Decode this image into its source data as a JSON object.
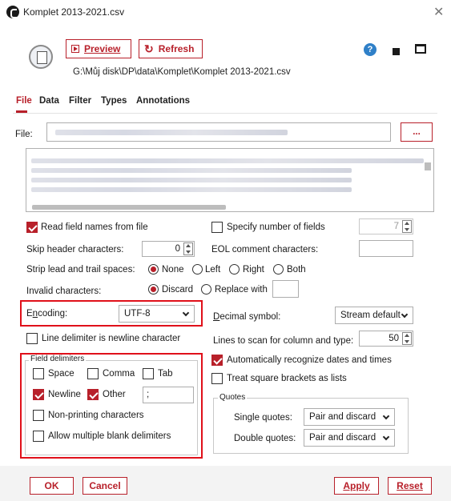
{
  "window": {
    "title": "Komplet 2013-2021.csv"
  },
  "header": {
    "preview_label": "Preview",
    "refresh_label": "Refresh",
    "path": "G:\\Můj disk\\DP\\data\\Komplet\\Komplet 2013-2021.csv"
  },
  "tabs": [
    "File",
    "Data",
    "Filter",
    "Types",
    "Annotations"
  ],
  "file": {
    "label": "File:",
    "browse": "..."
  },
  "options": {
    "read_field_names": "Read field names from file",
    "specify_num_fields": "Specify number of fields",
    "num_fields_value": "7",
    "skip_header_label": "Skip header characters:",
    "skip_header_value": "0",
    "eol_comment_label": "EOL comment characters:",
    "strip_label": "Strip lead and trail spaces:",
    "strip_none": "None",
    "strip_left": "Left",
    "strip_right": "Right",
    "strip_both": "Both",
    "invalid_label": "Invalid characters:",
    "invalid_discard": "Discard",
    "invalid_replace": "Replace with",
    "encoding_label": "Encoding:",
    "encoding_value": "UTF-8",
    "decimal_label": "Decimal symbol:",
    "decimal_value": "Stream default",
    "line_delim": "Line delimiter is newline character",
    "lines_scan_label": "Lines to scan for column and type:",
    "lines_scan_value": "50",
    "auto_dates": "Automatically recognize dates and times",
    "square_brackets": "Treat square brackets as lists"
  },
  "field_delimiters": {
    "legend": "Field delimiters",
    "space": "Space",
    "comma": "Comma",
    "tab": "Tab",
    "newline": "Newline",
    "other": "Other",
    "other_value": ";",
    "non_printing": "Non-printing characters",
    "multi_blank": "Allow multiple blank delimiters"
  },
  "quotes": {
    "legend": "Quotes",
    "single_label": "Single quotes:",
    "single_value": "Pair and discard",
    "double_label": "Double quotes:",
    "double_value": "Pair and discard"
  },
  "footer": {
    "ok": "OK",
    "cancel": "Cancel",
    "apply": "Apply",
    "reset": "Reset"
  },
  "colors": {
    "accent": "#b8202a",
    "highlight_frame": "#e0101a",
    "help": "#2f80c8"
  }
}
